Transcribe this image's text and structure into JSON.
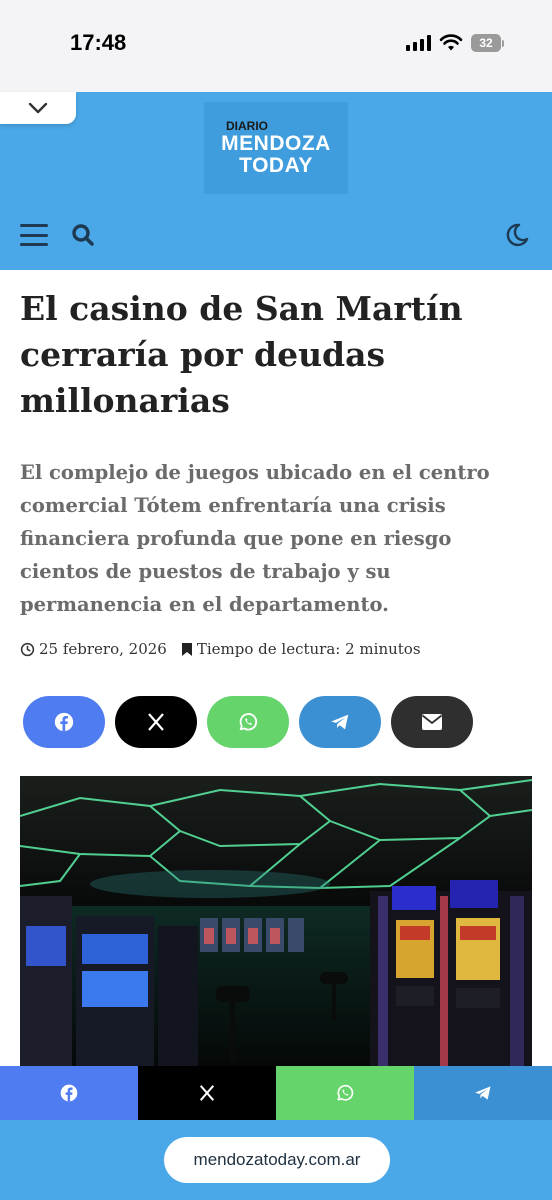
{
  "status_bar": {
    "time": "17:48",
    "battery": "32"
  },
  "header": {
    "logo": {
      "line1": "DIARIO",
      "line2": "MENDOZA",
      "line3": "TODAY"
    },
    "icons": {
      "menu": "hamburger-menu-icon",
      "search": "search-icon",
      "dark_mode": "moon-icon",
      "collapse": "chevron-down-icon"
    }
  },
  "article": {
    "title": "El casino de San Martín cerraría por deudas millonarias",
    "subtitle": "El complejo de juegos ubicado en el centro comercial Tótem enfrentaría una crisis financiera profunda que pone en riesgo cientos de puestos de trabajo y su permanencia en el departamento.",
    "date": "25 febrero, 2026",
    "reading_time": "Tiempo de lectura: 2 minutos"
  },
  "share": [
    {
      "network": "facebook",
      "icon": "facebook-icon",
      "color": "#4f7cf0"
    },
    {
      "network": "x",
      "icon": "x-icon",
      "color": "#000000"
    },
    {
      "network": "whatsapp",
      "icon": "whatsapp-icon",
      "color": "#65d56b"
    },
    {
      "network": "telegram",
      "icon": "telegram-icon",
      "color": "#3b8fd3"
    },
    {
      "network": "email",
      "icon": "email-icon",
      "color": "#2f2f2f"
    }
  ],
  "sticky_share": [
    {
      "network": "facebook",
      "color": "#4f7cf0"
    },
    {
      "network": "x",
      "color": "#000000"
    },
    {
      "network": "whatsapp",
      "color": "#65d56b"
    },
    {
      "network": "telegram",
      "color": "#3b8fd3"
    }
  ],
  "browser": {
    "url": "mendozatoday.com.ar"
  },
  "colors": {
    "header": "#4aa8e8",
    "title": "#222222",
    "subtitle": "#6b6b6b"
  }
}
